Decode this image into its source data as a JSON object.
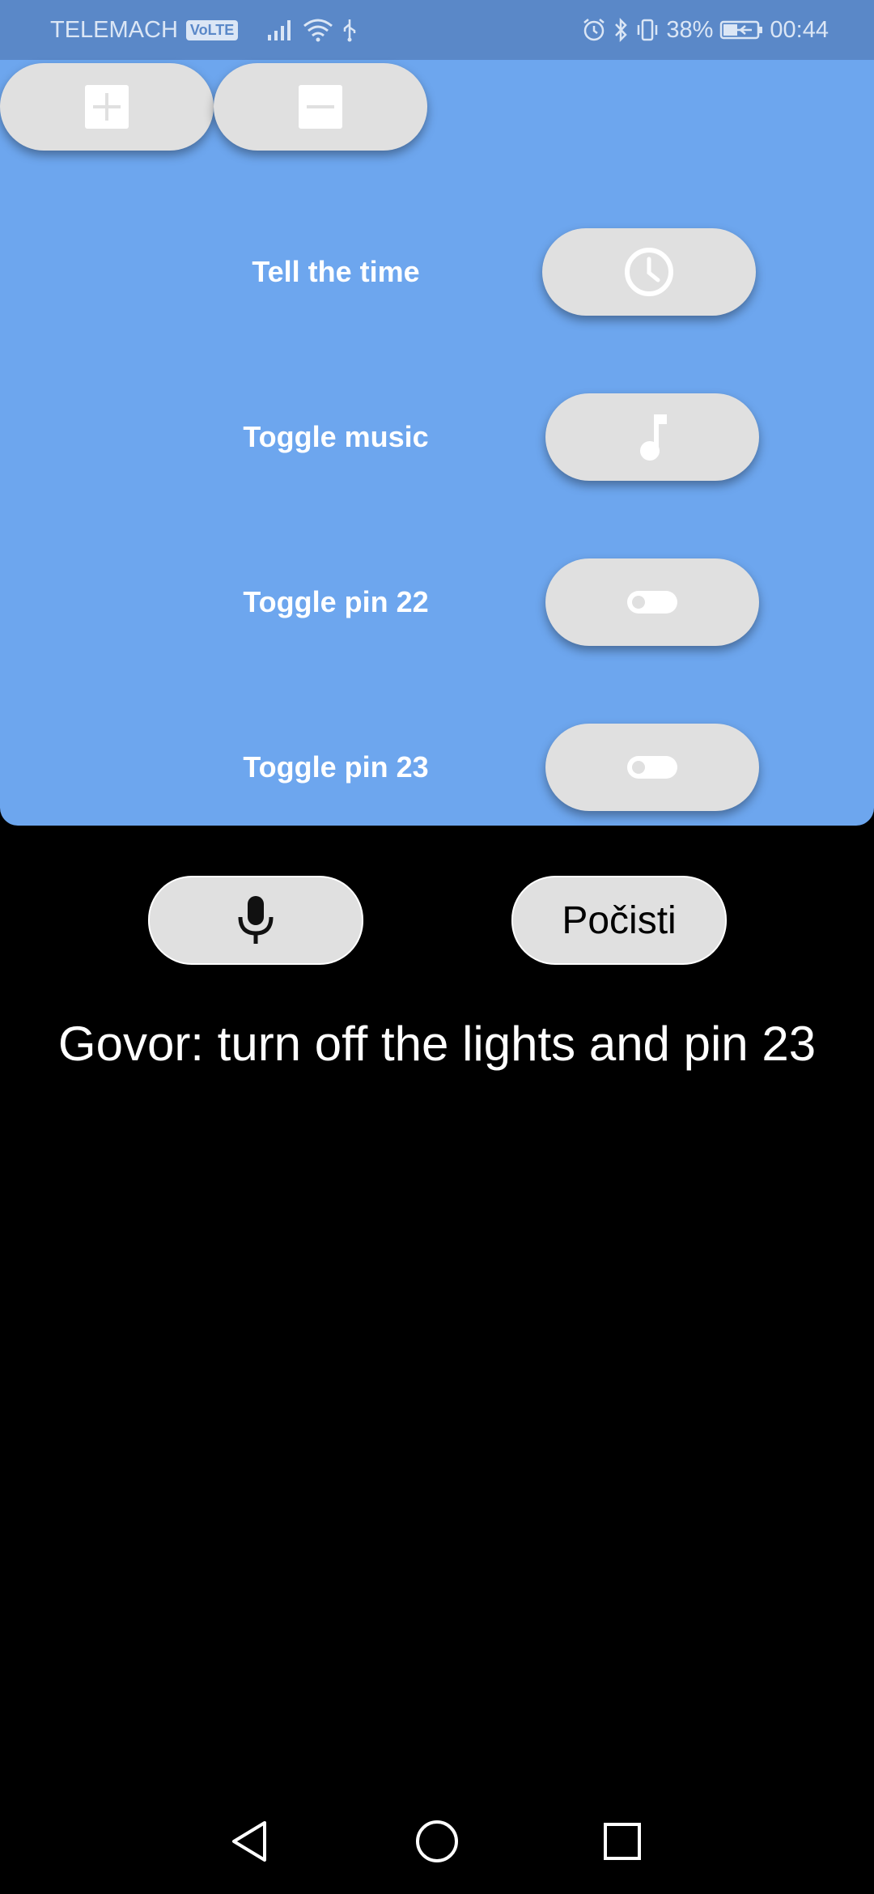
{
  "status_bar": {
    "carrier": "TELEMACH",
    "volte": "VoLTE",
    "battery": "38%",
    "time": "00:44"
  },
  "toolbar": {
    "add_icon": "plus-icon",
    "remove_icon": "minus-icon"
  },
  "commands": [
    {
      "label": "Tell the time",
      "icon": "clock-icon"
    },
    {
      "label": "Toggle music",
      "icon": "music-note-icon"
    },
    {
      "label": "Toggle pin 22",
      "icon": "toggle-icon"
    },
    {
      "label": "Toggle pin 23",
      "icon": "toggle-icon"
    }
  ],
  "controls": {
    "mic_icon": "microphone-icon",
    "clear_label": "Počisti"
  },
  "speech": {
    "text": "Govor: turn off the lights and pin 23"
  },
  "colors": {
    "status_bar": "#5a88c8",
    "panel": "#6da6ee",
    "button": "#e0e0e0",
    "background": "#000000"
  }
}
